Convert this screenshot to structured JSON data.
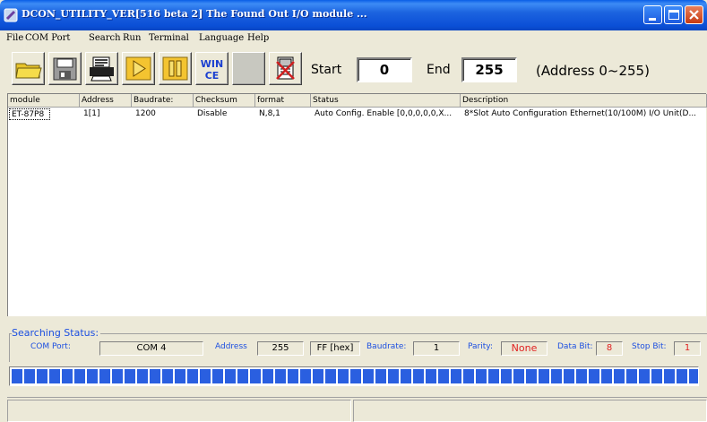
{
  "window": {
    "title": "DCON_UTILITY_VER[516 beta 2] The Found Out I/O module ..."
  },
  "menu": [
    "File",
    "COM Port",
    "Search",
    "Run",
    "Terminal",
    "Language",
    "Help"
  ],
  "toolbar": {
    "icons": [
      "open-folder-icon",
      "save-disk-icon",
      "print-icon",
      "play-icon",
      "pause-icon",
      "wince-icon",
      "blank-icon",
      "stop-module-icon"
    ],
    "wince_label": "WIN CE",
    "start_label": "Start",
    "start_value": "0",
    "end_label": "End",
    "end_value": "255",
    "range_text": "(Address 0~255)"
  },
  "table": {
    "columns": [
      "module",
      "Address",
      "Baudrate:",
      "Checksum",
      "format",
      "Status",
      "Description"
    ],
    "rows": [
      [
        "ET-87P8",
        "1[1]",
        "1200",
        "Disable",
        "N,8,1",
        "Auto Config. Enable [0,0,0,0,0,X...",
        "8*Slot Auto Configuration Ethernet(10/100M) I/O Unit(D..."
      ]
    ]
  },
  "search_status": {
    "legend": "Searching Status:",
    "com_port_label": "COM Port:",
    "com_port_value": "COM 4",
    "address_label": "Address",
    "address_value": "255",
    "address_hex": "FF [hex]",
    "baudrate_label": "Baudrate:",
    "baudrate_value": "1",
    "parity_label": "Parity:",
    "parity_value": "None",
    "databit_label": "Data Bit:",
    "databit_value": "8",
    "stopbit_label": "Stop Bit:",
    "stopbit_value": "1"
  },
  "progress": {
    "fraction": 1.0
  },
  "colors": {
    "titlebar": "#0B4FD6",
    "status_label": "#1C4FE0",
    "alert_value": "#E02020",
    "progress": "#2A5FE0"
  }
}
